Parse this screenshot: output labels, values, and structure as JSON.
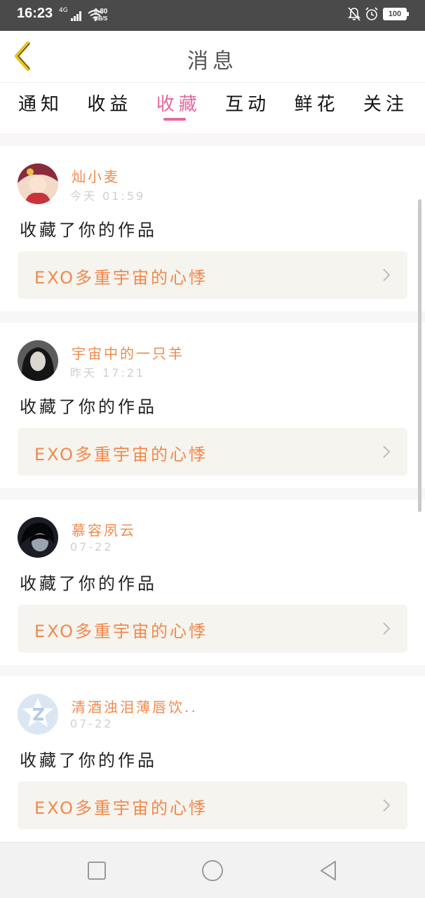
{
  "status_bar": {
    "time": "16:23",
    "network": "4G",
    "speed_value": "0.80",
    "speed_unit": "KB/S",
    "battery": "100"
  },
  "header": {
    "title": "消息",
    "back_icon": "chevron-left-icon"
  },
  "tabs": [
    {
      "label": "通知",
      "active": false
    },
    {
      "label": "收益",
      "active": false
    },
    {
      "label": "收藏",
      "active": true
    },
    {
      "label": "互动",
      "active": false
    },
    {
      "label": "鲜花",
      "active": false
    },
    {
      "label": "关注",
      "active": false
    }
  ],
  "notifications": [
    {
      "user": "灿小麦",
      "time": "今天 01:59",
      "action": "收藏了你的作品",
      "work_title": "EXO多重宇宙的心悸"
    },
    {
      "user": "宇宙中的一只羊",
      "time": "昨天 17:21",
      "action": "收藏了你的作品",
      "work_title": "EXO多重宇宙的心悸"
    },
    {
      "user": "慕容夙云",
      "time": "07-22",
      "action": "收藏了你的作品",
      "work_title": "EXO多重宇宙的心悸"
    },
    {
      "user": "清酒浊泪薄唇饮..",
      "time": "07-22",
      "action": "收藏了你的作品",
      "work_title": "EXO多重宇宙的心悸"
    }
  ],
  "colors": {
    "accent_pink": "#e5679f",
    "username_orange": "#f0894d",
    "back_arrow": "#e7c11f"
  },
  "nav_bar": [
    "square-icon",
    "circle-icon",
    "triangle-back-icon"
  ]
}
